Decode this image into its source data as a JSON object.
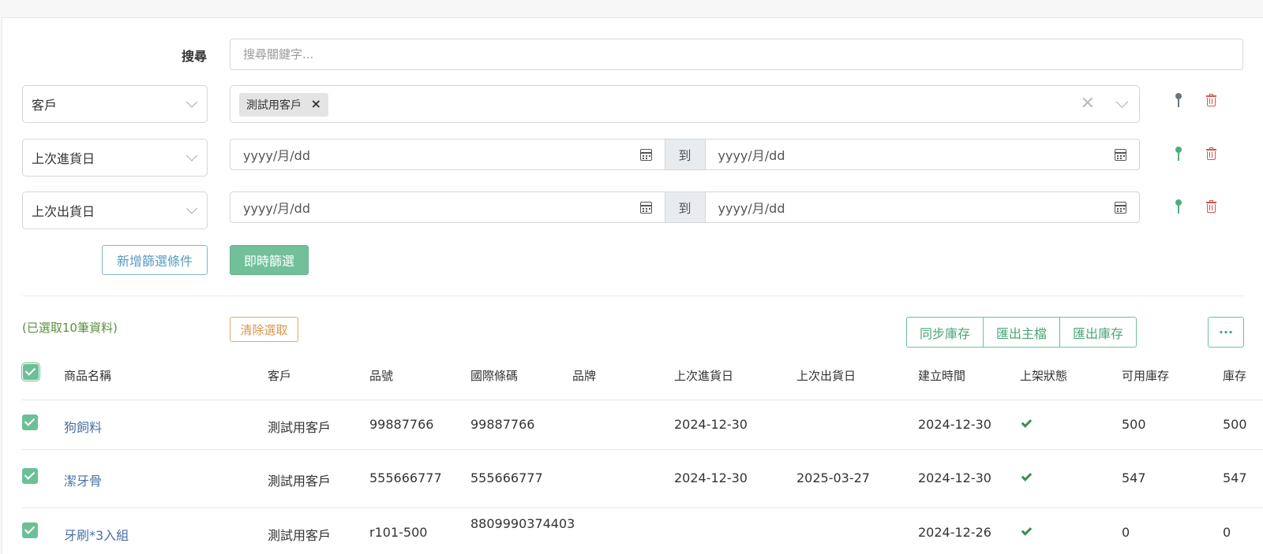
{
  "search": {
    "label": "搜尋",
    "placeholder": "搜尋關鍵字..."
  },
  "filters": [
    {
      "field": "客戶",
      "tag": "測試用客戶"
    },
    {
      "field": "上次進貨日",
      "from_placeholder": "yyyy/月/dd",
      "sep": "到",
      "to_placeholder": "yyyy/月/dd"
    },
    {
      "field": "上次出貨日",
      "from_placeholder": "yyyy/月/dd",
      "sep": "到",
      "to_placeholder": "yyyy/月/dd"
    }
  ],
  "actions": {
    "add_filter": "新增篩選條件",
    "apply_filter": "即時篩選"
  },
  "selection": {
    "count_text": "(已選取10筆資料)",
    "clear": "清除選取"
  },
  "toolbar": {
    "sync_stock": "同步庫存",
    "export_master": "匯出主檔",
    "export_stock": "匯出庫存",
    "more": "···"
  },
  "table": {
    "columns": [
      "商品名稱",
      "客戶",
      "品號",
      "國際條碼",
      "品牌",
      "上次進貨日",
      "上次出貨日",
      "建立時間",
      "上架狀態",
      "可用庫存",
      "庫存"
    ],
    "rows": [
      {
        "name": "狗飼料",
        "customer": "測試用客戶",
        "sku": "99887766",
        "barcode": "99887766",
        "brand": "",
        "last_in": "2024-12-30",
        "last_out": "",
        "created": "2024-12-30",
        "listed": true,
        "available": "500",
        "stock": "500"
      },
      {
        "name": "潔牙骨",
        "customer": "測試用客戶",
        "sku": "555666777",
        "barcode": "555666777",
        "brand": "",
        "last_in": "2024-12-30",
        "last_out": "2025-03-27",
        "created": "2024-12-30",
        "listed": true,
        "available": "547",
        "stock": "547"
      },
      {
        "name": "牙刷*3入組",
        "customer": "測試用客戶",
        "sku": "r101-500",
        "barcode": "8809990374403",
        "brand": "",
        "last_in": "",
        "last_out": "",
        "created": "2024-12-26",
        "listed": true,
        "available": "0",
        "stock": "0"
      }
    ]
  },
  "colors": {
    "primary_green": "#72c09a",
    "info_blue": "#5a9bbf",
    "warning_orange": "#d9954a",
    "danger_red": "#d9534f",
    "link_blue": "#4a6fa5"
  }
}
